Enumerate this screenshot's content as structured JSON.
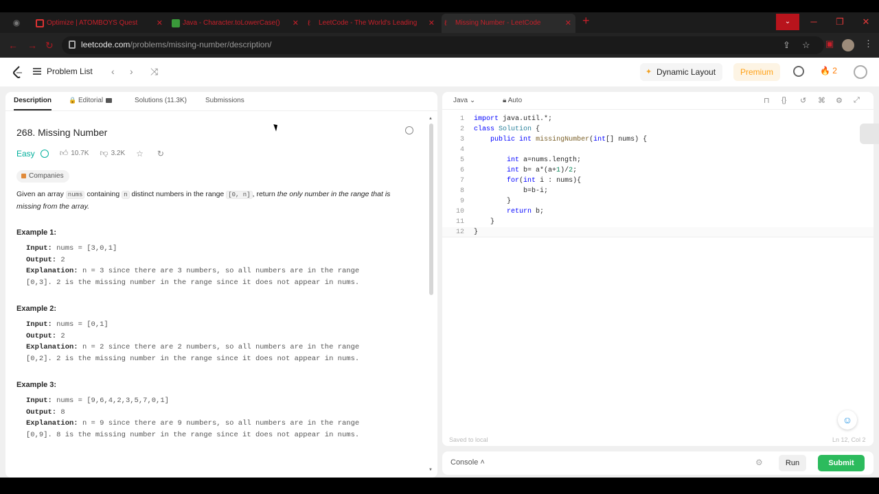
{
  "browser": {
    "tabs": [
      {
        "title": "Optimize | ATOMBOYS Quest"
      },
      {
        "title": "Java - Character.toLowerCase()"
      },
      {
        "title": "LeetCode - The World's Leading"
      },
      {
        "title": "Missing Number - LeetCode"
      }
    ],
    "url_domain": "leetcode.com",
    "url_path": "/problems/missing-number/description/"
  },
  "nav": {
    "problem_list": "Problem List",
    "dynamic_layout": "Dynamic Layout",
    "premium": "Premium",
    "streak": "2"
  },
  "left": {
    "tabs": {
      "description": "Description",
      "editorial": "Editorial",
      "solutions": "Solutions (11.3K)",
      "submissions": "Submissions"
    },
    "title": "268. Missing Number",
    "difficulty": "Easy",
    "likes": "10.7K",
    "dislikes": "3.2K",
    "companies": "Companies",
    "desc_1": "Given an array",
    "desc_code_nums": "nums",
    "desc_2": "containing",
    "desc_code_n": "n",
    "desc_3": "distinct numbers in the range",
    "desc_code_range": "[0, n]",
    "desc_4": ", return",
    "desc_em": "the only number in the range that is missing from the array.",
    "examples": [
      {
        "heading": "Example 1:",
        "input_label": "Input:",
        "input": "nums = [3,0,1]",
        "output_label": "Output:",
        "output": "2",
        "expl_label": "Explanation:",
        "expl_1": "n = 3 since there are 3 numbers, so all numbers are in the range",
        "expl_2": "[0,3]. 2 is the missing number in the range since it does not appear in nums."
      },
      {
        "heading": "Example 2:",
        "input_label": "Input:",
        "input": "nums = [0,1]",
        "output_label": "Output:",
        "output": "2",
        "expl_label": "Explanation:",
        "expl_1": "n = 2 since there are 2 numbers, so all numbers are in the range",
        "expl_2": "[0,2]. 2 is the missing number in the range since it does not appear in nums."
      },
      {
        "heading": "Example 3:",
        "input_label": "Input:",
        "input": "nums = [9,6,4,2,3,5,7,0,1]",
        "output_label": "Output:",
        "output": "8",
        "expl_label": "Explanation:",
        "expl_1": "n = 9 since there are 9 numbers, so all numbers are in the range",
        "expl_2": "[0,9]. 8 is the missing number in the range since it does not appear in nums."
      }
    ]
  },
  "editor": {
    "language": "Java",
    "mode": "Auto",
    "lines": [
      {
        "n": "1",
        "code": "import java.util.*;"
      },
      {
        "n": "2",
        "code": "class Solution {"
      },
      {
        "n": "3",
        "code": "    public int missingNumber(int[] nums) {"
      },
      {
        "n": "4",
        "code": ""
      },
      {
        "n": "5",
        "code": "        int a=nums.length;"
      },
      {
        "n": "6",
        "code": "        int b= a*(a+1)/2;"
      },
      {
        "n": "7",
        "code": "        for(int i : nums){"
      },
      {
        "n": "8",
        "code": "            b=b-i;"
      },
      {
        "n": "9",
        "code": "        }"
      },
      {
        "n": "10",
        "code": "        return b;"
      },
      {
        "n": "11",
        "code": "    }"
      },
      {
        "n": "12",
        "code": "}"
      }
    ],
    "saved": "Saved to local",
    "cursor_pos": "Ln 12, Col 2"
  },
  "footer": {
    "console": "Console",
    "run": "Run",
    "submit": "Submit"
  },
  "colors": {
    "accent_easy": "#00af9b",
    "premium": "#ffa116",
    "submit": "#2cbb5d",
    "browser_tab_text": "#c8202a"
  }
}
